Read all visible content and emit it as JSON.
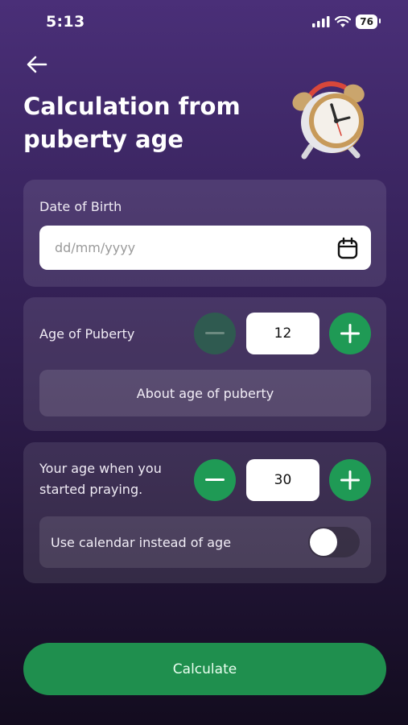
{
  "status_bar": {
    "time": "5:13",
    "battery": "76"
  },
  "header": {
    "title": "Calculation from puberty age"
  },
  "dob": {
    "label": "Date of Birth",
    "placeholder": "dd/mm/yyyy"
  },
  "puberty": {
    "label": "Age of Puberty",
    "value": "12",
    "about_label": "About age of puberty",
    "decrement_disabled": true
  },
  "praying": {
    "label": "Your age when you started praying.",
    "value": "30",
    "toggle_label": "Use calendar instead of age",
    "toggle_on": false
  },
  "actions": {
    "calculate_label": "Calculate"
  },
  "colors": {
    "accent_green": "#1f9a55",
    "bg_top": "#4a2f78",
    "bg_bottom": "#130c1f"
  },
  "icons": [
    "back-arrow-icon",
    "calendar-icon",
    "minus-icon",
    "plus-icon",
    "alarm-clock-icon",
    "signal-icon",
    "wifi-icon"
  ]
}
